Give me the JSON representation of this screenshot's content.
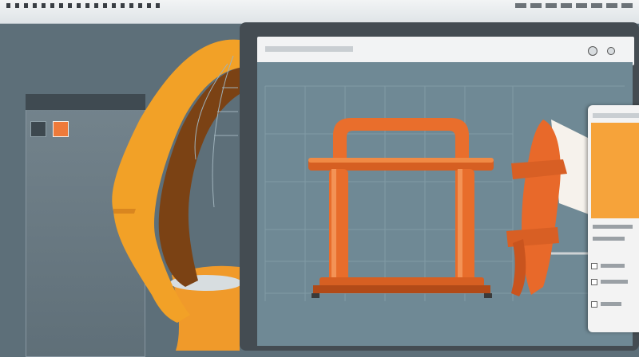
{
  "window": {
    "title": ""
  },
  "toolbar": {
    "icons": [
      "select-tool-icon",
      "shape-tool-icon"
    ]
  },
  "viewport": {
    "model": "orange-pipe-frame"
  },
  "colors": {
    "accent": "#ee7a3a",
    "accent_light": "#f6a33a",
    "viewport_bg": "#6f8995",
    "chrome": "#444c52"
  }
}
